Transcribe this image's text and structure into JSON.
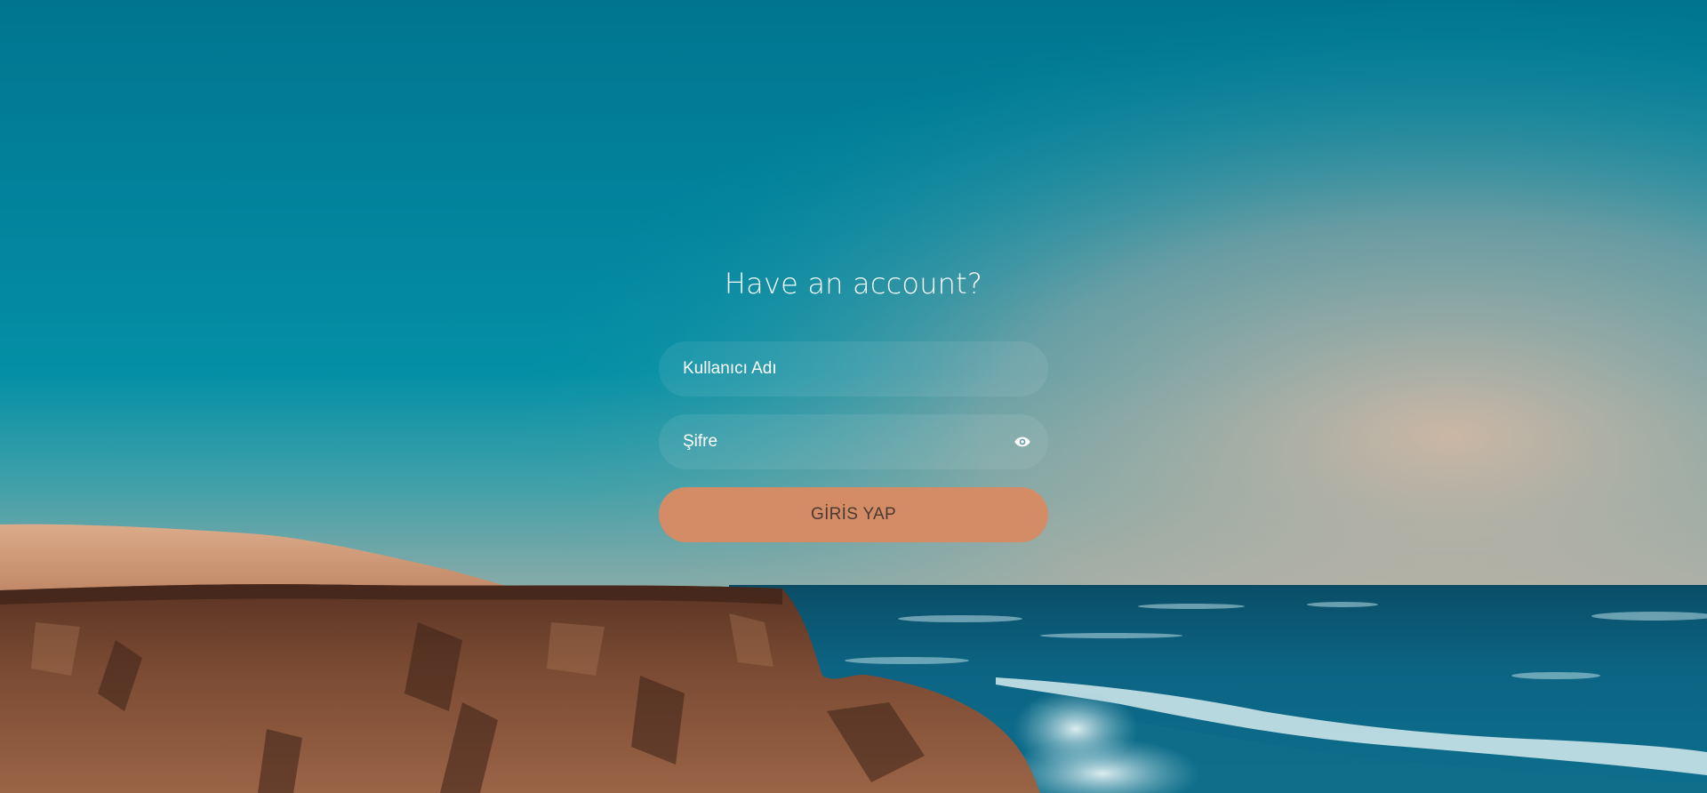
{
  "login": {
    "title": "Have an account?",
    "username_placeholder": "Kullanıcı Adı",
    "password_placeholder": "Şifre",
    "submit_label": "GİRİS YAP",
    "toggle_icon": "eye-icon"
  },
  "colors": {
    "sky_top": "#037a92",
    "sky_mid": "#0292a6",
    "horizon_haze": "#b9a595",
    "sea": "#0b5d78",
    "rock": "#6b3f2a",
    "sand": "#d5a07f",
    "button": "#d38c65",
    "button_text": "#4b3a34"
  }
}
